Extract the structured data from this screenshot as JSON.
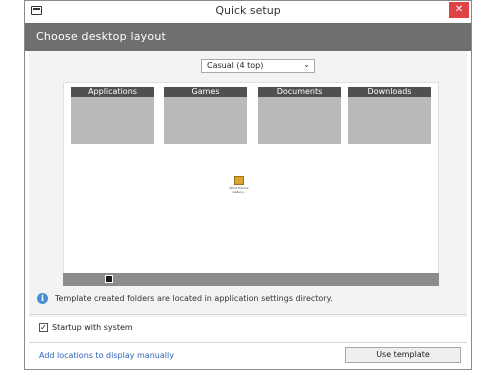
{
  "window": {
    "title": "Quick setup",
    "close_label": "✕",
    "header": "Choose desktop layout"
  },
  "layout_select": {
    "value": "Casual (4 top)"
  },
  "preview": {
    "folders": [
      {
        "label": "Applications"
      },
      {
        "label": "Games"
      },
      {
        "label": "Documents"
      },
      {
        "label": "Downloads"
      }
    ],
    "center_icon_caption": "Word Picture Gallery..."
  },
  "info": {
    "text": "Template created folders are located in application settings directory."
  },
  "startup": {
    "checked": true,
    "label": "Startup with system"
  },
  "footer": {
    "link_text": "Add locations to display manually",
    "button_label": "Use template"
  },
  "colors": {
    "header_bg": "#6f6f6f",
    "close_bg": "#e04343",
    "link": "#2d63b6",
    "info_icon": "#4a8fd6"
  }
}
